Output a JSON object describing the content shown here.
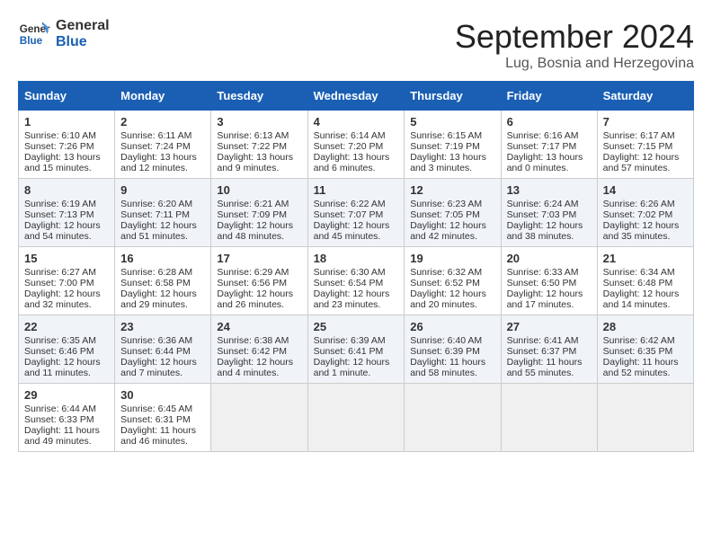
{
  "logo": {
    "line1": "General",
    "line2": "Blue"
  },
  "title": "September 2024",
  "location": "Lug, Bosnia and Herzegovina",
  "days_of_week": [
    "Sunday",
    "Monday",
    "Tuesday",
    "Wednesday",
    "Thursday",
    "Friday",
    "Saturday"
  ],
  "weeks": [
    [
      {
        "num": "1",
        "sunrise": "6:10 AM",
        "sunset": "7:26 PM",
        "daylight": "13 hours and 15 minutes."
      },
      {
        "num": "2",
        "sunrise": "6:11 AM",
        "sunset": "7:24 PM",
        "daylight": "13 hours and 12 minutes."
      },
      {
        "num": "3",
        "sunrise": "6:13 AM",
        "sunset": "7:22 PM",
        "daylight": "13 hours and 9 minutes."
      },
      {
        "num": "4",
        "sunrise": "6:14 AM",
        "sunset": "7:20 PM",
        "daylight": "13 hours and 6 minutes."
      },
      {
        "num": "5",
        "sunrise": "6:15 AM",
        "sunset": "7:19 PM",
        "daylight": "13 hours and 3 minutes."
      },
      {
        "num": "6",
        "sunrise": "6:16 AM",
        "sunset": "7:17 PM",
        "daylight": "13 hours and 0 minutes."
      },
      {
        "num": "7",
        "sunrise": "6:17 AM",
        "sunset": "7:15 PM",
        "daylight": "12 hours and 57 minutes."
      }
    ],
    [
      {
        "num": "8",
        "sunrise": "6:19 AM",
        "sunset": "7:13 PM",
        "daylight": "12 hours and 54 minutes."
      },
      {
        "num": "9",
        "sunrise": "6:20 AM",
        "sunset": "7:11 PM",
        "daylight": "12 hours and 51 minutes."
      },
      {
        "num": "10",
        "sunrise": "6:21 AM",
        "sunset": "7:09 PM",
        "daylight": "12 hours and 48 minutes."
      },
      {
        "num": "11",
        "sunrise": "6:22 AM",
        "sunset": "7:07 PM",
        "daylight": "12 hours and 45 minutes."
      },
      {
        "num": "12",
        "sunrise": "6:23 AM",
        "sunset": "7:05 PM",
        "daylight": "12 hours and 42 minutes."
      },
      {
        "num": "13",
        "sunrise": "6:24 AM",
        "sunset": "7:03 PM",
        "daylight": "12 hours and 38 minutes."
      },
      {
        "num": "14",
        "sunrise": "6:26 AM",
        "sunset": "7:02 PM",
        "daylight": "12 hours and 35 minutes."
      }
    ],
    [
      {
        "num": "15",
        "sunrise": "6:27 AM",
        "sunset": "7:00 PM",
        "daylight": "12 hours and 32 minutes."
      },
      {
        "num": "16",
        "sunrise": "6:28 AM",
        "sunset": "6:58 PM",
        "daylight": "12 hours and 29 minutes."
      },
      {
        "num": "17",
        "sunrise": "6:29 AM",
        "sunset": "6:56 PM",
        "daylight": "12 hours and 26 minutes."
      },
      {
        "num": "18",
        "sunrise": "6:30 AM",
        "sunset": "6:54 PM",
        "daylight": "12 hours and 23 minutes."
      },
      {
        "num": "19",
        "sunrise": "6:32 AM",
        "sunset": "6:52 PM",
        "daylight": "12 hours and 20 minutes."
      },
      {
        "num": "20",
        "sunrise": "6:33 AM",
        "sunset": "6:50 PM",
        "daylight": "12 hours and 17 minutes."
      },
      {
        "num": "21",
        "sunrise": "6:34 AM",
        "sunset": "6:48 PM",
        "daylight": "12 hours and 14 minutes."
      }
    ],
    [
      {
        "num": "22",
        "sunrise": "6:35 AM",
        "sunset": "6:46 PM",
        "daylight": "12 hours and 11 minutes."
      },
      {
        "num": "23",
        "sunrise": "6:36 AM",
        "sunset": "6:44 PM",
        "daylight": "12 hours and 7 minutes."
      },
      {
        "num": "24",
        "sunrise": "6:38 AM",
        "sunset": "6:42 PM",
        "daylight": "12 hours and 4 minutes."
      },
      {
        "num": "25",
        "sunrise": "6:39 AM",
        "sunset": "6:41 PM",
        "daylight": "12 hours and 1 minute."
      },
      {
        "num": "26",
        "sunrise": "6:40 AM",
        "sunset": "6:39 PM",
        "daylight": "11 hours and 58 minutes."
      },
      {
        "num": "27",
        "sunrise": "6:41 AM",
        "sunset": "6:37 PM",
        "daylight": "11 hours and 55 minutes."
      },
      {
        "num": "28",
        "sunrise": "6:42 AM",
        "sunset": "6:35 PM",
        "daylight": "11 hours and 52 minutes."
      }
    ],
    [
      {
        "num": "29",
        "sunrise": "6:44 AM",
        "sunset": "6:33 PM",
        "daylight": "11 hours and 49 minutes."
      },
      {
        "num": "30",
        "sunrise": "6:45 AM",
        "sunset": "6:31 PM",
        "daylight": "11 hours and 46 minutes."
      },
      null,
      null,
      null,
      null,
      null
    ]
  ]
}
